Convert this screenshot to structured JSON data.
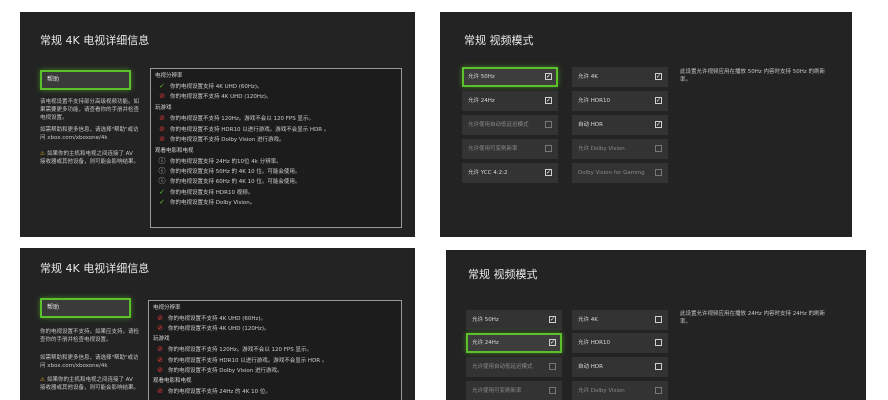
{
  "tl": {
    "title": "常规 4K 电视详细信息",
    "side_button": "帮助",
    "note1": "该电视设置不支持部分高级视频功能。如果需要更多功能，请查看你的手册并检查电视设置。",
    "note2": "如需帮助和更多信息，请选择\"帮助\"或访问 xbox.com/xboxone/4k",
    "note3": "如果你的主机和电视之间连接了 AV 接收器或其他设备，则可能会影响结果。",
    "sections": [
      {
        "label": "电视分辨率",
        "rows": [
          {
            "icon": "check",
            "text": "你的电视设置支持 4K UHD (60Hz)。"
          },
          {
            "icon": "cross",
            "text": "你的电视设置不支持 4K UHD (120Hz)。"
          }
        ]
      },
      {
        "label": "玩游戏",
        "rows": [
          {
            "icon": "cross",
            "text": "你的电视设置不支持 120Hz。游戏不会以 120 FPS 显示。"
          },
          {
            "icon": "cross",
            "text": "你的电视设置不支持 HDR10 以进行游戏。游戏不会显示 HDR 。"
          },
          {
            "icon": "cross",
            "text": "你的电视设置不支持 Dolby Vision 进行游戏。"
          }
        ]
      },
      {
        "label": "观看电影和电视",
        "rows": [
          {
            "icon": "info",
            "text": "你的电视设置支持 24Hz 的10位 4k 分辨率。"
          },
          {
            "icon": "info",
            "text": "你的电视设置支持 50Hz 的 4K 10 位。可能会使用。"
          },
          {
            "icon": "info",
            "text": "你的电视设置支持 60Hz 的 4K 10 位。可能会使用。"
          },
          {
            "icon": "check",
            "text": "你的电视设置支持 HDR10 视频。"
          },
          {
            "icon": "check",
            "text": "你的电视设置支持 Dolby Vision。"
          }
        ]
      }
    ]
  },
  "tr": {
    "title": "常规 视频模式",
    "left_options": [
      {
        "label": "允许 50Hz",
        "checked": true,
        "selected": true,
        "dim": false
      },
      {
        "label": "允许 24Hz",
        "checked": true,
        "selected": false,
        "dim": false
      },
      {
        "label": "允许使用自动低延迟模式",
        "checked": false,
        "selected": false,
        "dim": true
      },
      {
        "label": "允许使用可变刷新率",
        "checked": false,
        "selected": false,
        "dim": true
      },
      {
        "label": "允许 YCC 4:2:2",
        "checked": true,
        "selected": false,
        "dim": false
      }
    ],
    "right_options": [
      {
        "label": "允许 4K",
        "checked": true,
        "selected": false,
        "dim": false
      },
      {
        "label": "允许 HDR10",
        "checked": true,
        "selected": false,
        "dim": false
      },
      {
        "label": "自动 HDR",
        "checked": true,
        "selected": false,
        "dim": false
      },
      {
        "label": "允许 Dolby Vision",
        "checked": false,
        "selected": false,
        "dim": true
      },
      {
        "label": "Dolby Vision for Gaming",
        "checked": false,
        "selected": false,
        "dim": true
      }
    ],
    "description": "此设置允许视频应用在播放 50Hz 内容时支持 50Hz 的刷新率。"
  },
  "bl": {
    "title": "常规 4K 电视详细信息",
    "side_button": "帮助",
    "note1": "你的电视设置不支持，如果应支持，请检查你的手册并检查电视设置。",
    "note2": "如需帮助和更多信息，请选择\"帮助\"或访问 xbox.com/xboxone/4k",
    "note3": "如果你的主机和电视之间连接了 AV 接收器或其他设备，则可能会影响结果。",
    "sections": [
      {
        "label": "电视分辨率",
        "rows": [
          {
            "icon": "cross",
            "text": "你的电视设置不支持 4K UHD (60Hz)。"
          },
          {
            "icon": "cross",
            "text": "你的电视设置不支持 4K UHD (120Hz)。"
          }
        ]
      },
      {
        "label": "玩游戏",
        "rows": [
          {
            "icon": "cross",
            "text": "你的电视设置不支持 120Hz。游戏不会以 120 FPS 显示。"
          },
          {
            "icon": "cross",
            "text": "你的电视设置不支持 HDR10 以进行游戏。游戏不会显示 HDR 。"
          },
          {
            "icon": "cross",
            "text": "你的电视设置不支持 Dolby Vision 进行游戏。"
          }
        ]
      },
      {
        "label": "观看电影和电视",
        "rows": [
          {
            "icon": "cross",
            "text": "你的电视设置不支持 24Hz 的 4K 10 位。"
          }
        ]
      }
    ]
  },
  "br": {
    "title": "常规 视频模式",
    "left_options": [
      {
        "label": "允许 50Hz",
        "checked": true,
        "selected": false,
        "dim": false
      },
      {
        "label": "允许 24Hz",
        "checked": true,
        "selected": true,
        "dim": false
      },
      {
        "label": "允许使用自动低延迟模式",
        "checked": false,
        "selected": false,
        "dim": true
      },
      {
        "label": "允许使用可变刷新率",
        "checked": false,
        "selected": false,
        "dim": true
      }
    ],
    "right_options": [
      {
        "label": "允许 4K",
        "checked": false,
        "selected": false,
        "dim": false
      },
      {
        "label": "允许 HDR10",
        "checked": false,
        "selected": false,
        "dim": false
      },
      {
        "label": "自动 HDR",
        "checked": false,
        "selected": false,
        "dim": false
      },
      {
        "label": "允许 Dolby Vision",
        "checked": false,
        "selected": false,
        "dim": true
      }
    ],
    "description": "此设置允许视频应用在播放 24Hz 内容时支持 24Hz 的刷新率。"
  },
  "colors": {
    "accent": "#5bc12a",
    "panel": "#232323",
    "tile": "#333333",
    "error": "#e03a3a"
  }
}
